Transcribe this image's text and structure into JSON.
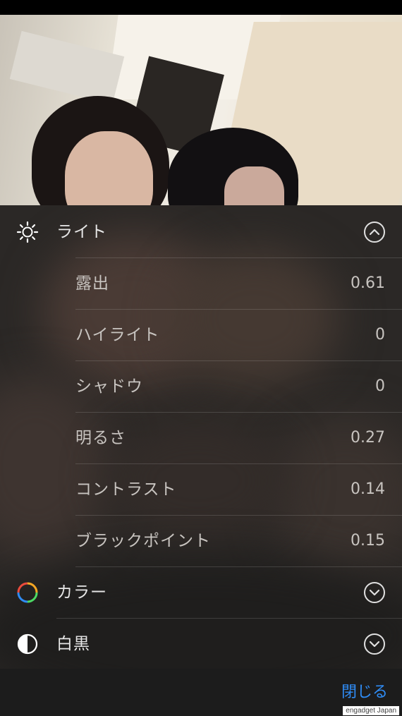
{
  "light_section": {
    "title": "ライト",
    "icon": "sun-icon",
    "expanded": true,
    "items": [
      {
        "label": "露出",
        "value": "0.61"
      },
      {
        "label": "ハイライト",
        "value": "0"
      },
      {
        "label": "シャドウ",
        "value": "0"
      },
      {
        "label": "明るさ",
        "value": "0.27"
      },
      {
        "label": "コントラスト",
        "value": "0.14"
      },
      {
        "label": "ブラックポイント",
        "value": "0.15"
      }
    ]
  },
  "color_section": {
    "title": "カラー",
    "icon": "color-wheel-icon",
    "expanded": false
  },
  "bw_section": {
    "title": "白黒",
    "icon": "half-circle-icon",
    "expanded": false
  },
  "bottom_bar": {
    "close_label": "閉じる"
  },
  "watermark": "engadget Japan",
  "colors": {
    "accent": "#2f8cf5",
    "panel_bg": "#2b2826",
    "bottom_bar": "#1c1c1c"
  }
}
